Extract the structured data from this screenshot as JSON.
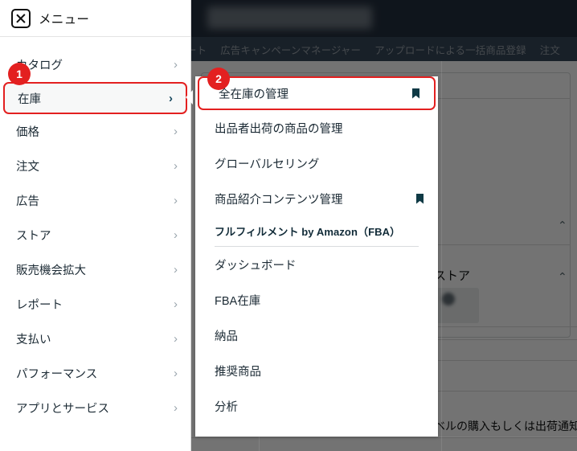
{
  "topbar": {
    "search_placeholder": "",
    "nav_links": [
      "ート",
      "広告キャンペーンマネージャー",
      "アップロードによる一括商品登録",
      "注文"
    ]
  },
  "sidebar": {
    "header": {
      "close_icon": "close-box-icon",
      "title": "メニュー"
    },
    "items": [
      {
        "label": "カタログ",
        "chevron": "›",
        "selected": false
      },
      {
        "label": "在庫",
        "chevron": "›",
        "selected": true
      },
      {
        "label": "価格",
        "chevron": "›",
        "selected": false
      },
      {
        "label": "注文",
        "chevron": "›",
        "selected": false
      },
      {
        "label": "広告",
        "chevron": "›",
        "selected": false
      },
      {
        "label": "ストア",
        "chevron": "›",
        "selected": false
      },
      {
        "label": "販売機会拡大",
        "chevron": "›",
        "selected": false
      },
      {
        "label": "レポート",
        "chevron": "›",
        "selected": false
      },
      {
        "label": "支払い",
        "chevron": "›",
        "selected": false
      },
      {
        "label": "パフォーマンス",
        "chevron": "›",
        "selected": false
      },
      {
        "label": "アプリとサービス",
        "chevron": "›",
        "selected": false
      }
    ]
  },
  "submenu": {
    "items": [
      {
        "label": "全在庫の管理",
        "bookmark": true,
        "selected": true
      },
      {
        "label": "出品者出荷の商品の管理",
        "bookmark": false,
        "selected": false
      },
      {
        "label": "グローバルセリング",
        "bookmark": false,
        "selected": false
      },
      {
        "label": "商品紹介コンテンツ管理",
        "bookmark": true,
        "selected": false
      }
    ],
    "section": {
      "title": "フルフィルメント by Amazon（FBA）",
      "items": [
        {
          "label": "ダッシュボード"
        },
        {
          "label": "FBA在庫"
        },
        {
          "label": "納品"
        },
        {
          "label": "推奨商品"
        },
        {
          "label": "分析"
        }
      ]
    }
  },
  "background": {
    "store_label": "ストア",
    "notice_text": "ベルの購入もしくは出荷通知"
  },
  "badges": [
    {
      "id": "1",
      "label": "1",
      "target": "sidebar-item-在庫"
    },
    {
      "id": "2",
      "label": "2",
      "target": "submenu-item-全在庫の管理"
    }
  ],
  "colors": {
    "accent_red": "#e32020",
    "topbar": "#232f3e",
    "navbar": "#37475a",
    "text_dark": "#1b2a34"
  }
}
